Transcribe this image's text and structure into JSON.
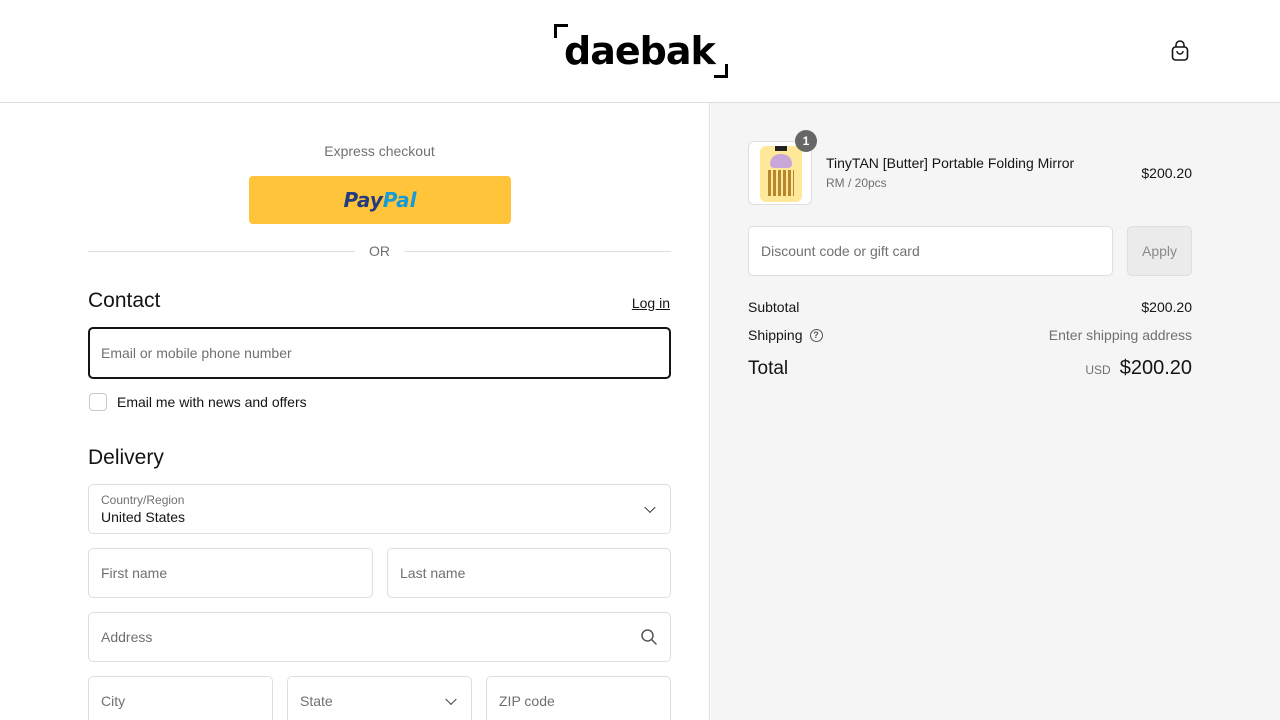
{
  "header": {
    "logo_text": "daebak",
    "cart_icon": "shopping-bag-icon"
  },
  "express": {
    "label": "Express checkout",
    "paypal_part1": "Pay",
    "paypal_part2": "Pal",
    "divider_text": "OR"
  },
  "contact": {
    "title": "Contact",
    "login_label": "Log in",
    "email_placeholder": "Email or mobile phone number",
    "newsletter_label": "Email me with news and offers",
    "newsletter_checked": false
  },
  "delivery": {
    "title": "Delivery",
    "country_label": "Country/Region",
    "country_value": "United States",
    "first_name_placeholder": "First name",
    "last_name_placeholder": "Last name",
    "address_placeholder": "Address",
    "city_placeholder": "City",
    "state_placeholder": "State",
    "zip_placeholder": "ZIP code"
  },
  "order": {
    "item": {
      "quantity": "1",
      "name": "TinyTAN [Butter] Portable Folding Mirror",
      "variant": "RM / 20pcs",
      "price": "$200.20"
    },
    "discount_placeholder": "Discount code or gift card",
    "apply_label": "Apply",
    "subtotal_label": "Subtotal",
    "subtotal_value": "$200.20",
    "shipping_label": "Shipping",
    "shipping_value": "Enter shipping address",
    "total_label": "Total",
    "currency": "USD",
    "total_value": "$200.20"
  },
  "colors": {
    "paypal_yellow": "#ffc439",
    "paypal_dark_blue": "#253b80",
    "paypal_light_blue": "#179bd7",
    "summary_background": "#f5f5f5"
  }
}
